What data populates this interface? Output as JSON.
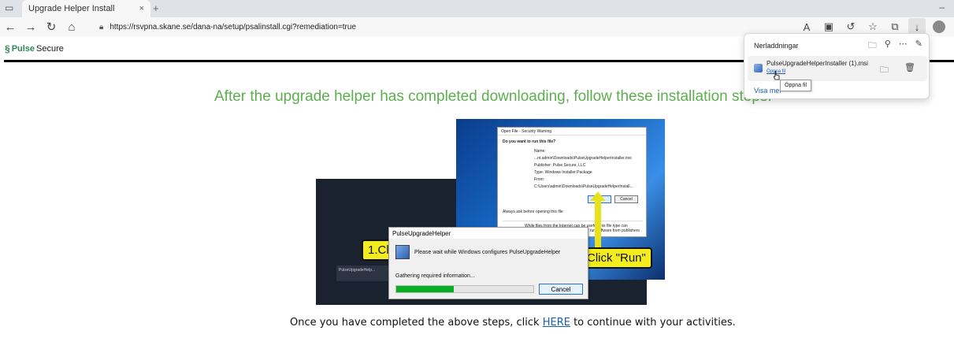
{
  "browser": {
    "tab_title": "Upgrade Helper Install",
    "tab_close": "×",
    "new_tab": "+",
    "address": "https://rsvpna.skane.se/dana-na/setup/psalinstall.cgi?remediation=true",
    "icons": [
      "back-icon",
      "forward-icon",
      "refresh-icon",
      "home-icon",
      "lock-icon",
      "read-aloud-icon",
      "extension-icon",
      "copilot-icon",
      "favorites-icon",
      "collections-icon",
      "download-icon",
      "profile-icon"
    ]
  },
  "site": {
    "logo_brand": "Pulse",
    "logo_product": "Secure"
  },
  "page": {
    "heading": "After the upgrade helper has completed downloading, follow these installation steps:",
    "footer_before": "Once you have completed the above steps, click ",
    "footer_link": "HERE",
    "footer_after": " to continue with your activities."
  },
  "illustration": {
    "security_dialog": {
      "title": "Open File - Security Warning",
      "question": "Do you want to run this file?",
      "name_row": "Name:   ...nt.admin\\Downloads\\PulseUpgradeHelperInstaller.msi",
      "publisher_row": "Publisher:   Pulse Secure, LLC",
      "type_row": "Type:   Windows Installer Package",
      "from_row": "From:   C:\\Users\\admin\\Downloads\\PulseUpgradeHelperInstall...",
      "run_button": "Run",
      "cancel_button": "Cancel",
      "checkbox_label": "Always ask before opening this file",
      "warning_text": "While files from the Internet can be useful, this file type can potentially harm your computer. Only run software from publishers you trust."
    },
    "callout_run": "Click \"Run\"",
    "callout_click": "1.Click",
    "taskbar_item": "PulseUpgradeHelp...",
    "installer": {
      "title": "PulseUpgradeHelper",
      "message": "Please wait while Windows configures PulseUpgradeHelper",
      "status": "Gathering required information...",
      "cancel": "Cancel",
      "progress": 0.42
    }
  },
  "downloads": {
    "title": "Nerladdningar",
    "file_name": "PulseUpgradeHelperInstaller (1).msi",
    "open_link": "Öppna fil",
    "show_more": "Visa mer",
    "tooltip": "Öppna fil"
  }
}
